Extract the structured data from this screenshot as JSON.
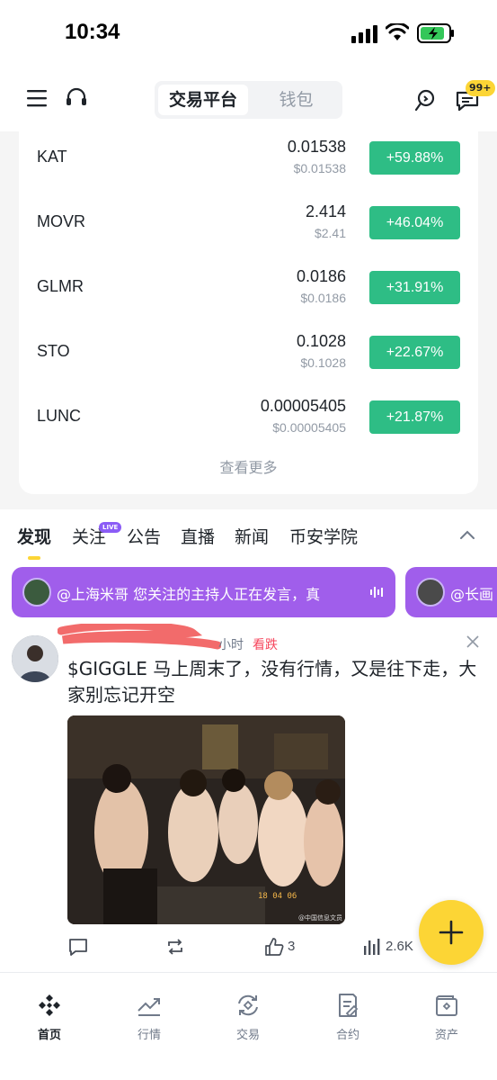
{
  "status_bar": {
    "time": "10:34"
  },
  "header": {
    "tabs": [
      "交易平台",
      "钱包"
    ],
    "active_tab": "交易平台",
    "message_badge": "99+"
  },
  "market": {
    "rows": [
      {
        "name": "KAT",
        "price": "0.01538",
        "usd": "$0.01538",
        "change": "+59.88%"
      },
      {
        "name": "MOVR",
        "price": "2.414",
        "usd": "$2.41",
        "change": "+46.04%"
      },
      {
        "name": "GLMR",
        "price": "0.0186",
        "usd": "$0.0186",
        "change": "+31.91%"
      },
      {
        "name": "STO",
        "price": "0.1028",
        "usd": "$0.1028",
        "change": "+22.67%"
      },
      {
        "name": "LUNC",
        "price": "0.00005405",
        "usd": "$0.00005405",
        "change": "+21.87%"
      }
    ],
    "see_more": "查看更多",
    "up_color": "#2ebd85"
  },
  "content_tabs": {
    "items": [
      "发现",
      "关注",
      "公告",
      "直播",
      "新闻",
      "币安学院"
    ],
    "active": "发现",
    "live_badge": "LIVE"
  },
  "live_banners": [
    {
      "text": "@上海米哥  您关注的主持人正在发言，真"
    },
    {
      "text": "@长画"
    }
  ],
  "post": {
    "time": "小时",
    "tag": "看跌",
    "text": "$GIGGLE 马上周末了，没有行情，又是往下走，大家别忘记开空",
    "image_stamp": "18 04 06",
    "image_watermark": "@中国信息文员",
    "actions": {
      "likes": "3",
      "views": "2.6K"
    }
  },
  "bottom_nav": {
    "items": [
      "首页",
      "行情",
      "交易",
      "合约",
      "资产"
    ],
    "active": "首页"
  },
  "colors": {
    "brand_yellow": "#fcd535",
    "live_purple": "#a05eeb",
    "bearish_red": "#f6465d"
  }
}
